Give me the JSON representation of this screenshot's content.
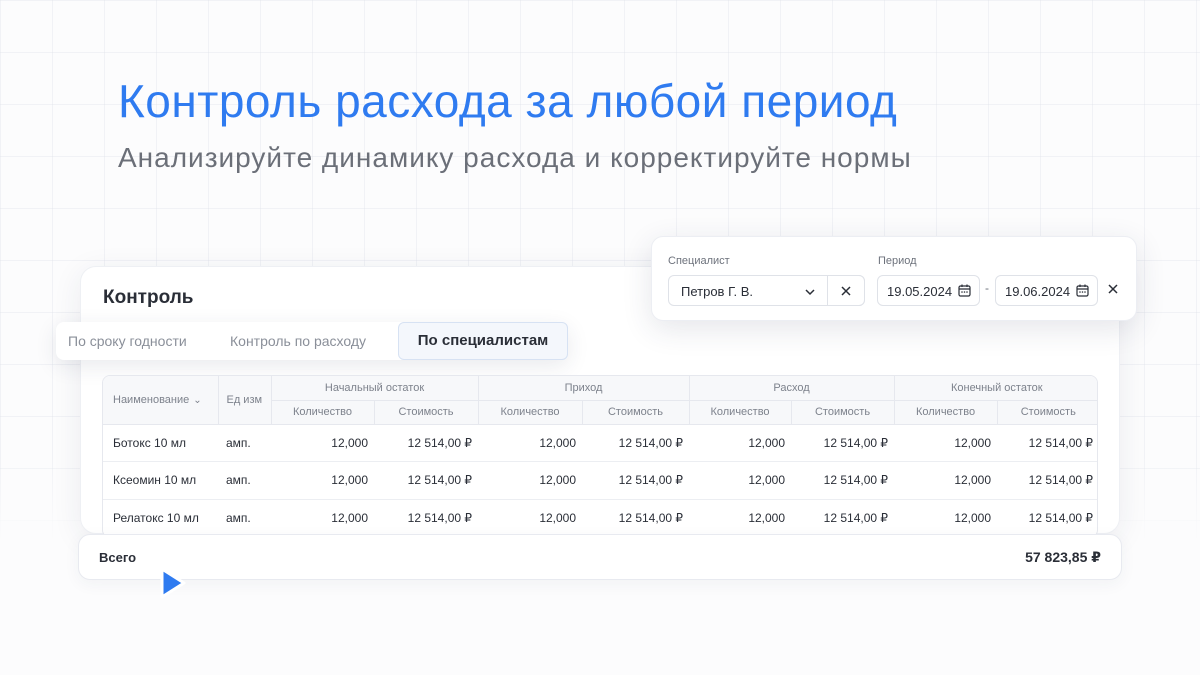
{
  "hero": {
    "title": "Контроль расхода за любой период",
    "subtitle": "Анализируйте динамику расхода и корректируйте нормы"
  },
  "card": {
    "title": "Контроль"
  },
  "tabs": [
    {
      "label": "По сроку годности"
    },
    {
      "label": "Контроль по расходу"
    },
    {
      "label": "По специалистам"
    }
  ],
  "filter": {
    "specialist_label": "Специалист",
    "specialist_value": "Петров Г. В.",
    "period_label": "Период",
    "date_from": "19.05.2024",
    "date_separator": "-",
    "date_to": "19.06.2024"
  },
  "table": {
    "headers": {
      "name": "Наименование",
      "unit": "Ед изм",
      "groups": [
        "Начальный остаток",
        "Приход",
        "Расход",
        "Конечный остаток"
      ],
      "qty": "Количество",
      "cost": "Стоимость"
    },
    "rows": [
      {
        "name": "Ботокс 10 мл",
        "unit": "амп.",
        "cells": [
          "12,000",
          "12 514,00 ₽",
          "12,000",
          "12 514,00 ₽",
          "12,000",
          "12 514,00 ₽",
          "12,000",
          "12 514,00 ₽"
        ]
      },
      {
        "name": "Ксеомин 10 мл",
        "unit": "амп.",
        "cells": [
          "12,000",
          "12 514,00 ₽",
          "12,000",
          "12 514,00 ₽",
          "12,000",
          "12 514,00 ₽",
          "12,000",
          "12 514,00 ₽"
        ]
      },
      {
        "name": "Релатокс 10 мл",
        "unit": "амп.",
        "cells": [
          "12,000",
          "12 514,00 ₽",
          "12,000",
          "12 514,00 ₽",
          "12,000",
          "12 514,00 ₽",
          "12,000",
          "12 514,00 ₽"
        ]
      }
    ]
  },
  "total": {
    "label": "Всего",
    "value": "57 823,85 ₽"
  },
  "colors": {
    "accent": "#2f7bf0",
    "text": "#2a2e37",
    "muted": "#8a8f99"
  }
}
